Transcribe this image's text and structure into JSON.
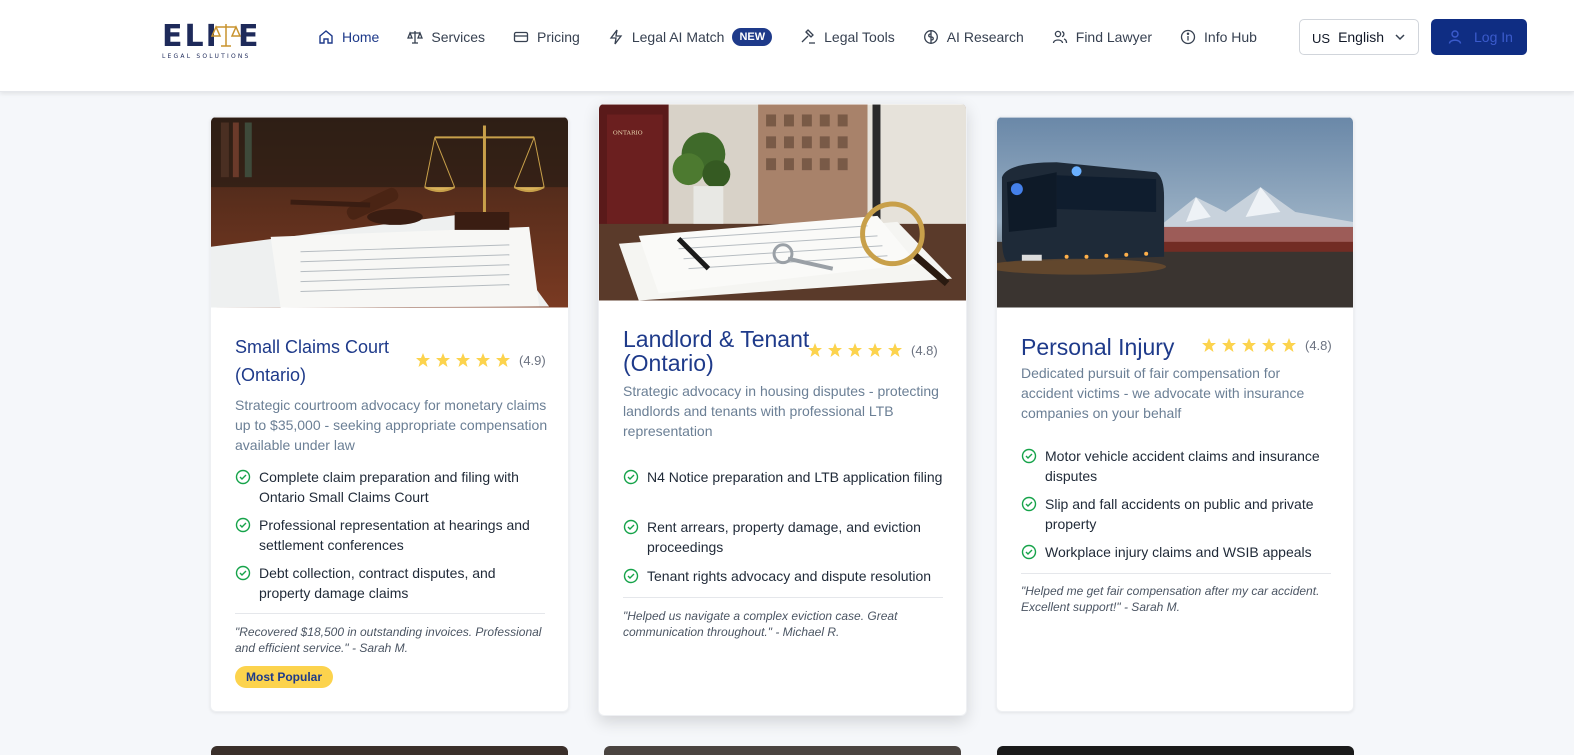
{
  "brand": {
    "name": "ELITE",
    "tagline": "LEGAL SOLUTIONS"
  },
  "nav": [
    {
      "label": "Home",
      "icon": "home-icon",
      "active": true
    },
    {
      "label": "Services",
      "icon": "scale-icon"
    },
    {
      "label": "Pricing",
      "icon": "card-icon"
    },
    {
      "label": "Legal AI Match",
      "icon": "bolt-icon",
      "badge": "NEW"
    },
    {
      "label": "Legal Tools",
      "icon": "gavel-icon"
    },
    {
      "label": "AI Research",
      "icon": "brain-icon"
    },
    {
      "label": "Find Lawyer",
      "icon": "users-icon"
    },
    {
      "label": "Info Hub",
      "icon": "info-icon"
    }
  ],
  "language": {
    "flag": "US",
    "label": "English"
  },
  "login": {
    "label": "Log In"
  },
  "cards": [
    {
      "title": "Small Claims Court (Ontario)",
      "rating": "(4.9)",
      "description": "Strategic courtroom advocacy for monetary claims up to $35,000 - seeking appropriate compensation available under law",
      "features": [
        "Complete claim preparation and filing with Ontario Small Claims Court",
        "Professional representation at hearings and settlement conferences",
        "Debt collection, contract disputes, and property damage claims"
      ],
      "testimonial": "\"Recovered $18,500 in outstanding invoices. Professional and efficient service.\" - Sarah M.",
      "badge": "Most Popular"
    },
    {
      "title": "Landlord & Tenant (Ontario)",
      "rating": "(4.8)",
      "description": "Strategic advocacy in housing disputes - protecting landlords and tenants with professional LTB representation",
      "features": [
        "N4 Notice preparation and LTB application filing",
        "Rent arrears, property damage, and eviction proceedings",
        "Tenant rights advocacy and dispute resolution"
      ],
      "testimonial": "\"Helped us navigate a complex eviction case. Great communication throughout.\" - Michael R."
    },
    {
      "title": "Personal Injury",
      "rating": "(4.8)",
      "description": "Dedicated pursuit of fair compensation for accident victims - we advocate with insurance companies on your behalf",
      "features": [
        "Motor vehicle accident claims and insurance disputes",
        "Slip and fall accidents on public and private property",
        "Workplace injury claims and WSIB appeals"
      ],
      "testimonial": "\"Helped me get fair compensation after my car accident. Excellent support!\" - Sarah M."
    }
  ],
  "colors": {
    "primary": "#1e3a8a",
    "star": "#fcd34d",
    "check": "#16a34a"
  }
}
